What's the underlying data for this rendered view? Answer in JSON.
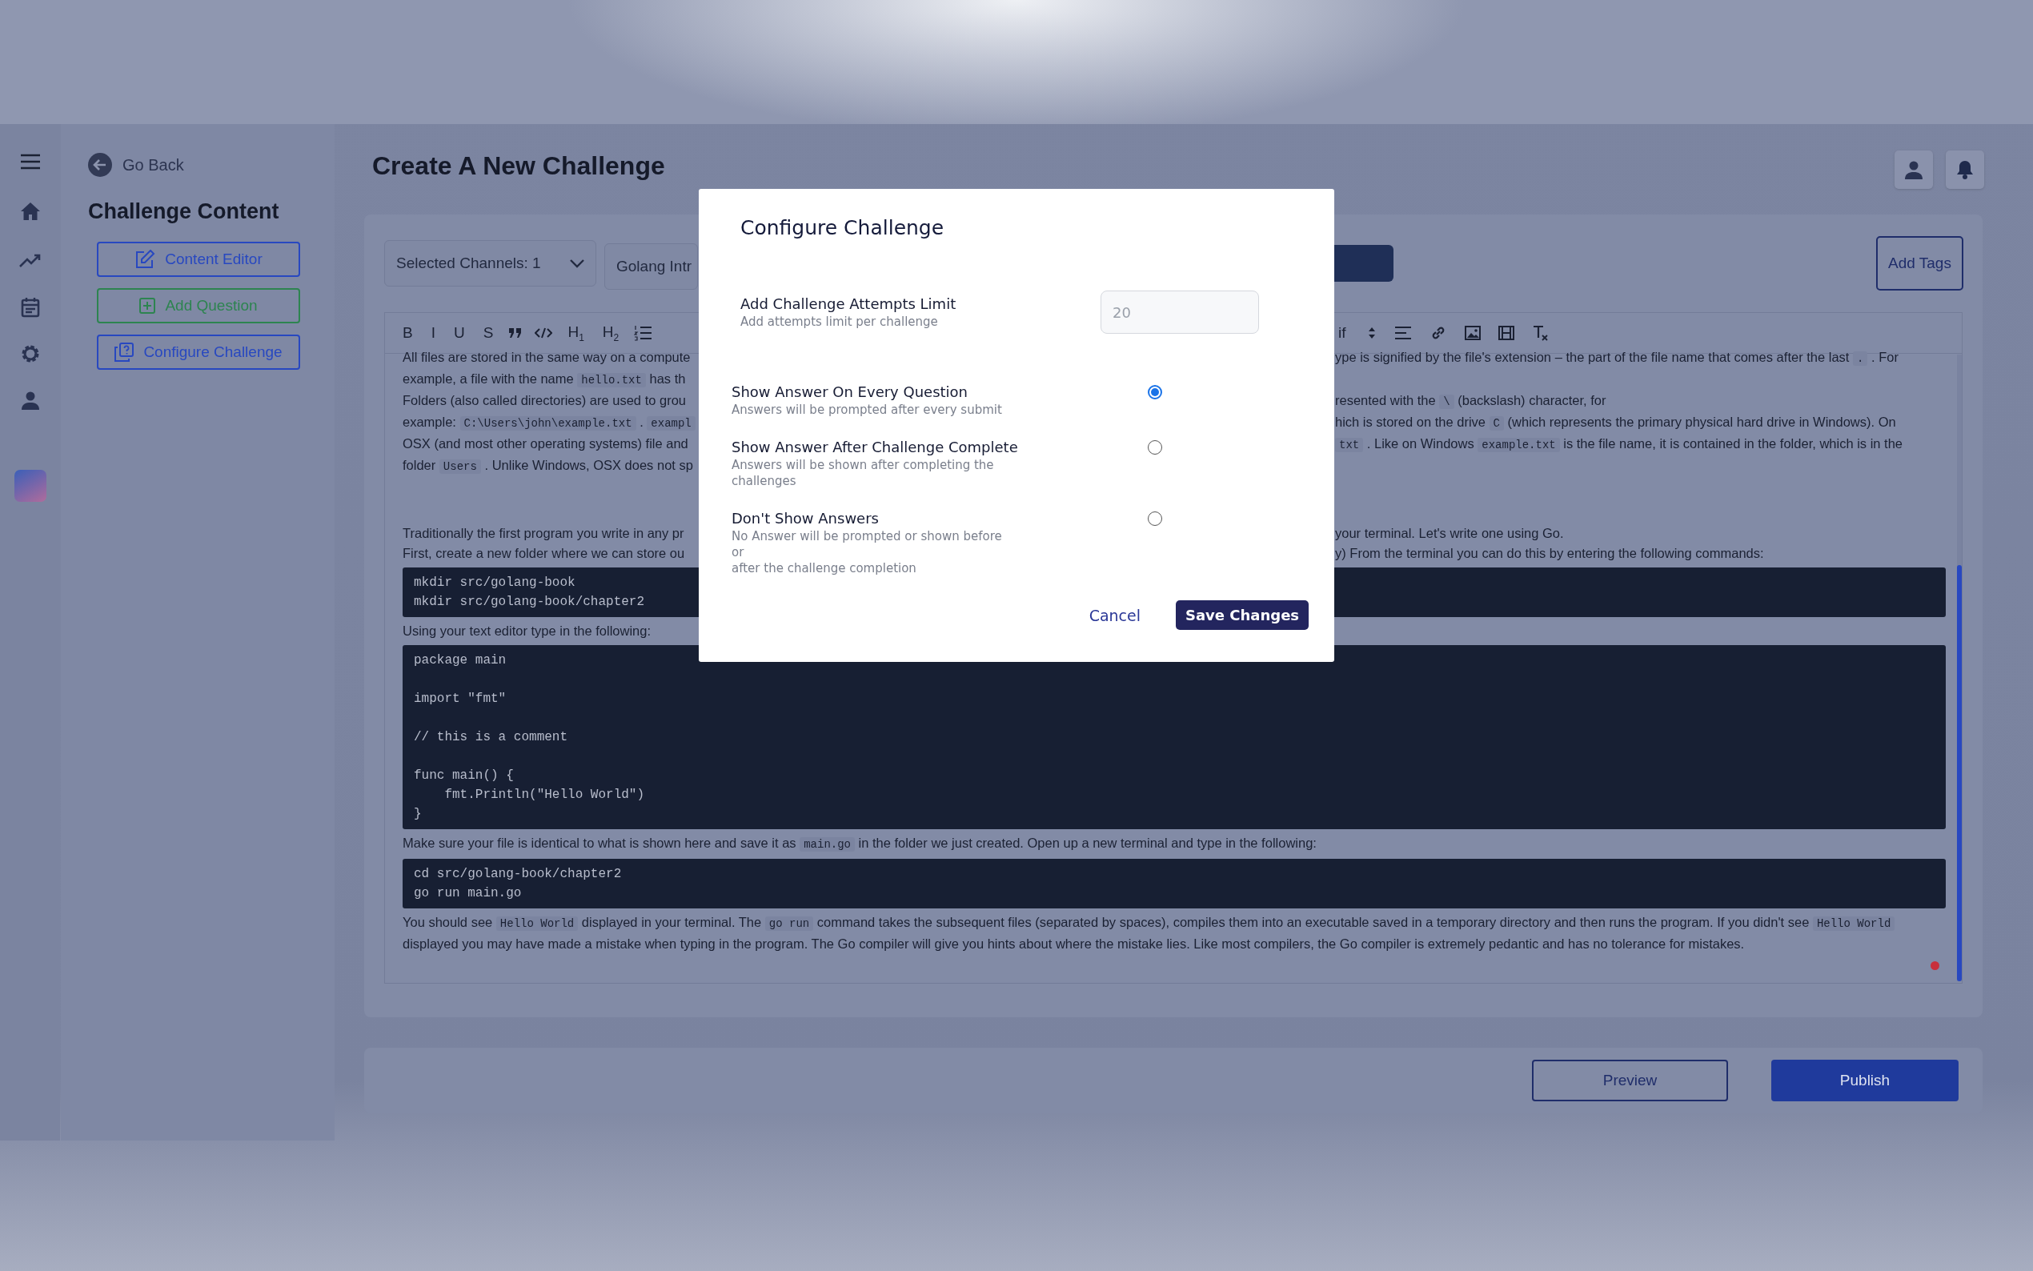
{
  "sidebar": {
    "back_link": "Go Back",
    "heading": "Challenge Content",
    "buttons": [
      {
        "label": "Content Editor",
        "kind": "edit"
      },
      {
        "label": "Add Question",
        "kind": "add"
      },
      {
        "label": "Configure Challenge",
        "kind": "config"
      }
    ]
  },
  "header": {
    "title": "Create A New Challenge"
  },
  "controls": {
    "channels_dropdown": "Selected Channels: 1",
    "name_field": "Golang Intr",
    "add_tags": "Add Tags"
  },
  "toolbar": {
    "left": [
      {
        "kind": "text",
        "label": "B"
      },
      {
        "kind": "text",
        "label": "I"
      },
      {
        "kind": "text",
        "label": "U"
      },
      {
        "kind": "text",
        "label": "S"
      },
      {
        "kind": "quote"
      },
      {
        "kind": "code"
      },
      {
        "kind": "text",
        "label": "H$_{1}$"
      },
      {
        "kind": "text",
        "label": "H$_{2}$"
      },
      {
        "kind": "list"
      }
    ],
    "right": [
      {
        "kind": "text",
        "label": "if"
      },
      {
        "kind": "stepper"
      },
      {
        "kind": "align"
      },
      {
        "kind": "link"
      },
      {
        "kind": "image"
      },
      {
        "kind": "video"
      },
      {
        "kind": "clear"
      }
    ]
  },
  "editor": {
    "blocks": [
      {
        "kind": "split",
        "left": [
          {
            "kind": "text",
            "text": "All files are stored in the same way on a compute"
          }
        ],
        "right": [
          {
            "kind": "text",
            "text": "ype is signified by the file's extension – the part of the file name that comes after the last "
          },
          {
            "kind": "code",
            "text": "."
          },
          {
            "kind": "text",
            "text": " . For"
          }
        ]
      },
      {
        "kind": "split",
        "left": [
          {
            "kind": "text",
            "text": "example, a file with the name "
          },
          {
            "kind": "code",
            "text": "hello.txt"
          },
          {
            "kind": "text",
            "text": " has th"
          }
        ]
      },
      {
        "kind": "split",
        "left": [
          {
            "kind": "text",
            "text": "Folders (also called directories) are used to grou"
          }
        ],
        "right": [
          {
            "kind": "text",
            "text": "resented with the "
          },
          {
            "kind": "code",
            "text": "\\"
          },
          {
            "kind": "text",
            "text": " (backslash) character, for"
          }
        ]
      },
      {
        "kind": "split",
        "left": [
          {
            "kind": "text",
            "text": "example: "
          },
          {
            "kind": "code",
            "text": "C:\\Users\\john\\example.txt"
          },
          {
            "kind": "text",
            "text": " . "
          },
          {
            "kind": "code",
            "text": "exampl"
          }
        ],
        "right": [
          {
            "kind": "text",
            "text": "hich is stored on the drive "
          },
          {
            "kind": "code",
            "text": "C"
          },
          {
            "kind": "text",
            "text": " (which represents the primary physical hard drive in Windows). On"
          }
        ]
      },
      {
        "kind": "split",
        "left": [
          {
            "kind": "text",
            "text": "OSX (and most other operating systems) file and"
          }
        ],
        "right": [
          {
            "kind": "code",
            "text": "txt"
          },
          {
            "kind": "text",
            "text": " . Like on Windows "
          },
          {
            "kind": "code",
            "text": "example.txt"
          },
          {
            "kind": "text",
            "text": " is the file name, it is contained in the folder, which is in the"
          }
        ]
      },
      {
        "kind": "split",
        "left": [
          {
            "kind": "text",
            "text": "folder "
          },
          {
            "kind": "code",
            "text": "Users"
          },
          {
            "kind": "text",
            "text": " . Unlike Windows, OSX does not sp"
          }
        ]
      },
      {
        "kind": "break"
      },
      {
        "kind": "split",
        "left": [
          {
            "kind": "text",
            "text": "Traditionally the first program you write in any pr"
          }
        ],
        "right": [
          {
            "kind": "text",
            "text": "your terminal. Let's write one using Go."
          }
        ]
      },
      {
        "kind": "split",
        "left": [
          {
            "kind": "text",
            "text": "First, create a new folder where we can store ou"
          }
        ],
        "right": [
          {
            "kind": "text",
            "text": "y) From the terminal you can do this by entering the following commands:"
          }
        ]
      },
      {
        "kind": "code",
        "groups": [
          [
            "mkdir src/golang-book",
            "mkdir src/golang-book/chapter2"
          ]
        ]
      },
      {
        "kind": "split",
        "left": [
          {
            "kind": "text",
            "text": "Using your text editor type in the following:"
          }
        ]
      },
      {
        "kind": "code",
        "groups": [
          [
            "package main"
          ],
          [
            "import \"fmt\""
          ],
          [
            "// this is a comment"
          ],
          [
            "func main() {",
            "    fmt.Println(\"Hello World\")",
            "}"
          ]
        ]
      },
      {
        "kind": "para",
        "segments": [
          {
            "kind": "text",
            "text": "Make sure your file is identical to what is shown here and save it as "
          },
          {
            "kind": "code",
            "text": "main.go"
          },
          {
            "kind": "text",
            "text": " in the folder we just created. Open up a new terminal and type in the following:"
          }
        ]
      },
      {
        "kind": "code",
        "groups": [
          [
            "cd src/golang-book/chapter2",
            "go run main.go"
          ]
        ]
      },
      {
        "kind": "para",
        "segments": [
          {
            "kind": "text",
            "text": "You should see "
          },
          {
            "kind": "code",
            "text": "Hello World"
          },
          {
            "kind": "text",
            "text": " displayed in your terminal. The "
          },
          {
            "kind": "code",
            "text": "go run"
          },
          {
            "kind": "text",
            "text": " command takes the subsequent files (separated by spaces), compiles them into an executable saved in a temporary directory and then runs the program. If you didn't see "
          },
          {
            "kind": "code",
            "text": "Hello World"
          },
          {
            "kind": "text",
            "text": " displayed you may have made a mistake when typing in the program. The Go compiler will give you hints about where the mistake lies. Like most compilers, the Go compiler is extremely pedantic and has no tolerance for mistakes."
          }
        ]
      }
    ]
  },
  "footer": {
    "preview": "Preview",
    "publish": "Publish"
  },
  "modal": {
    "title": "Configure Challenge",
    "attempts": {
      "label": "Add Challenge Attempts Limit",
      "hint": "Add attempts limit per challenge",
      "value": "20"
    },
    "options": [
      {
        "label": "Show Answer On Every Question",
        "hint": "Answers will be prompted after every submit",
        "selected": true
      },
      {
        "label": "Show Answer After Challenge Complete",
        "hint": "Answers will be shown after completing the\nchallenges",
        "selected": false
      },
      {
        "label": "Don't Show Answers",
        "hint": "No Answer will be prompted or shown before\nor\nafter the challenge completion",
        "selected": false
      }
    ],
    "cancel": "Cancel",
    "save": "Save Changes"
  }
}
